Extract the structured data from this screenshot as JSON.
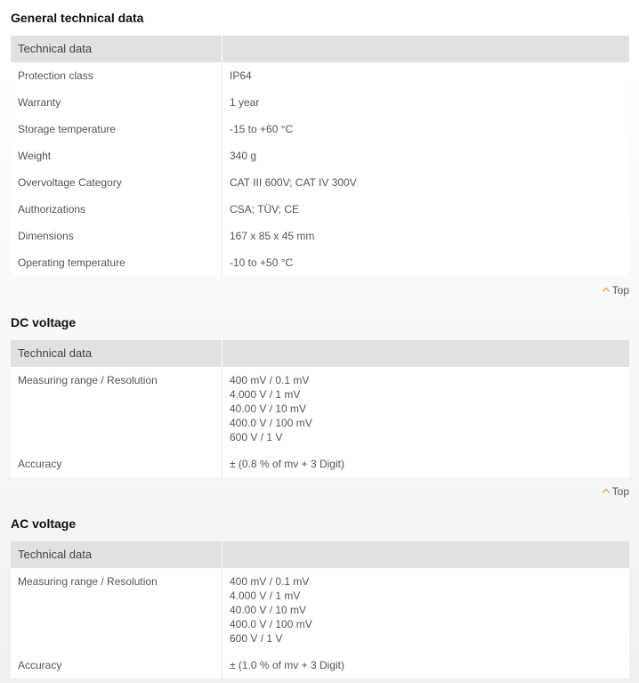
{
  "sections": [
    {
      "title": "General technical data",
      "header": "Technical data",
      "rows": [
        {
          "label": "Protection class",
          "values": [
            "IP64"
          ]
        },
        {
          "label": "Warranty",
          "values": [
            "1 year"
          ]
        },
        {
          "label": "Storage temperature",
          "values": [
            "-15 to +60 °C"
          ]
        },
        {
          "label": "Weight",
          "values": [
            "340 g"
          ]
        },
        {
          "label": "Overvoltage Category",
          "values": [
            "CAT III 600V; CAT IV 300V"
          ]
        },
        {
          "label": "Authorizations",
          "values": [
            "CSA; TÜV; CE"
          ]
        },
        {
          "label": "Dimensions",
          "values": [
            "167 x 85 x 45 mm"
          ]
        },
        {
          "label": "Operating temperature",
          "values": [
            "-10 to +50 °C"
          ]
        }
      ],
      "top_label": "Top"
    },
    {
      "title": "DC voltage",
      "header": "Technical data",
      "rows": [
        {
          "label": "Measuring range / Resolution",
          "values": [
            "400 mV / 0.1 mV",
            "4.000 V / 1 mV",
            "40.00 V / 10 mV",
            "400.0 V / 100 mV",
            "600 V / 1 V"
          ]
        },
        {
          "label": "Accuracy",
          "values": [
            "± (0.8 % of mv + 3 Digit)"
          ]
        }
      ],
      "top_label": "Top"
    },
    {
      "title": "AC voltage",
      "header": "Technical data",
      "rows": [
        {
          "label": "Measuring range / Resolution",
          "values": [
            "400 mV / 0.1 mV",
            "4.000 V / 1 mV",
            "40.00 V / 10 mV",
            "400.0 V / 100 mV",
            "600 V / 1 V"
          ]
        },
        {
          "label": "Accuracy",
          "values": [
            "± (1.0 % of mv + 3 Digit)"
          ]
        }
      ]
    }
  ],
  "colors": {
    "header_bg": "#dfe1e3",
    "accent": "#e8931a",
    "title": "#111111",
    "text": "#555555"
  }
}
